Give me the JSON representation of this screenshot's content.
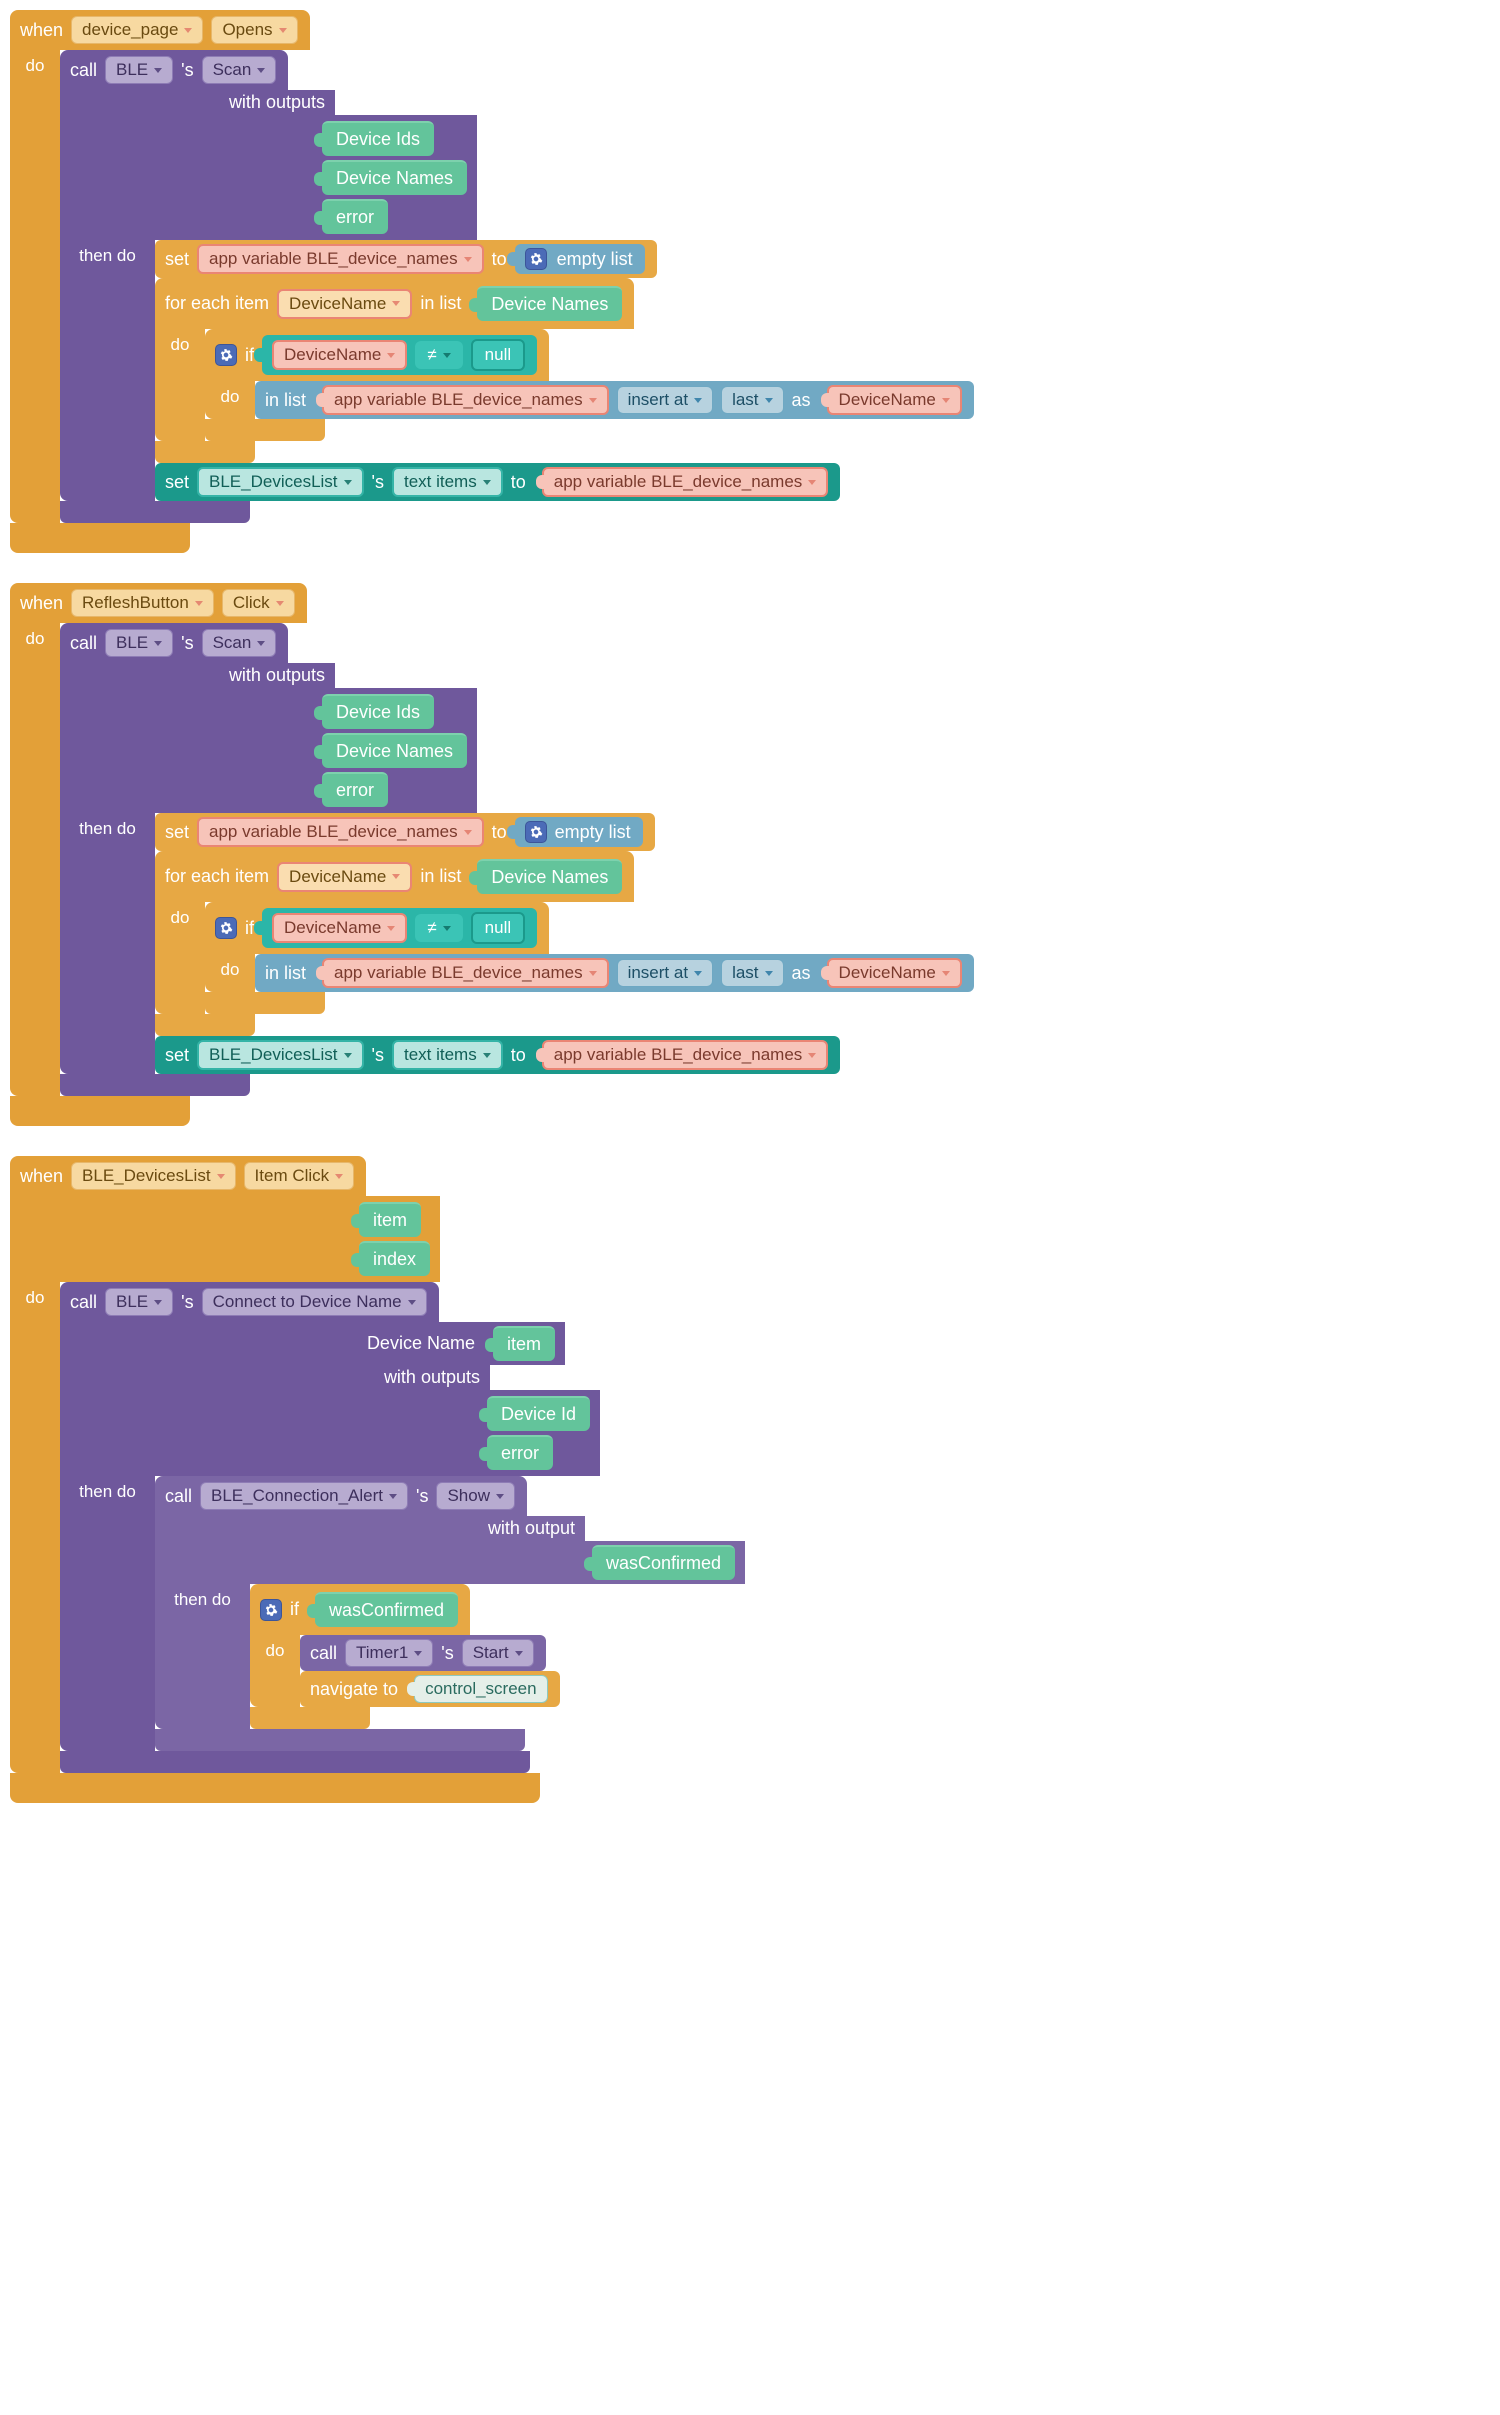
{
  "kw": {
    "when": "when",
    "do": "do",
    "then_do": "then do",
    "call": "call",
    "s": "'s",
    "with_outputs": "with outputs",
    "with_output": "with output",
    "set": "set",
    "to": "to",
    "for_each_item": "for each item",
    "in_list_kw": "in list",
    "if": "if",
    "in_list": "in list",
    "insert_at": "insert at",
    "as": "as",
    "navigate_to": "navigate to",
    "device_name_lbl": "Device Name",
    "last": "last",
    "ne": "≠",
    "null": "null",
    "empty_list": "empty list"
  },
  "outputs": {
    "device_ids": "Device Ids",
    "device_names": "Device Names",
    "error": "error",
    "item": "item",
    "index": "index",
    "device_id": "Device Id",
    "was_confirmed": "wasConfirmed"
  },
  "dd": {
    "device_page": "device_page",
    "opens": "Opens",
    "ble": "BLE",
    "scan": "Scan",
    "app_var_names": "app variable BLE_device_names",
    "device_name": "DeviceName",
    "ble_devices_list": "BLE_DevicesList",
    "text_items": "text items",
    "reflesh_button": "RefleshButton",
    "click": "Click",
    "item_click": "Item Click",
    "connect_to_device_name": "Connect to Device Name",
    "ble_connection_alert": "BLE_Connection_Alert",
    "show": "Show",
    "timer1": "Timer1",
    "start": "Start",
    "control_screen": "control_screen"
  }
}
